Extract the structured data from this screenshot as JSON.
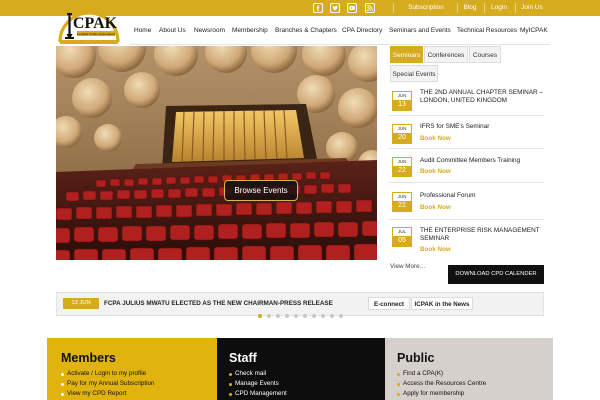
{
  "topbar": {
    "social_icons": [
      "facebook-icon",
      "twitter-icon",
      "youtube-icon",
      "rss-icon"
    ],
    "links": [
      "Subscription Renewal",
      "Blog",
      "Login",
      "Join Us"
    ]
  },
  "brand": {
    "logo_text": "CPAK",
    "logo_tagline": "Certified Public Accountants"
  },
  "nav": {
    "items": [
      "Home",
      "About Us",
      "Newsroom",
      "Membership",
      "Branches & Chapters",
      "CPA Directory",
      "Seminars and Events",
      "Technical Resources",
      "MyICPAK"
    ]
  },
  "hero": {
    "button_label": "Browse Events"
  },
  "events": {
    "tabs": [
      "Seminars",
      "Conferences",
      "Courses",
      "Special Events"
    ],
    "active_tab": "Seminars",
    "items": [
      {
        "month": "JUN",
        "day": "13",
        "title": "THE 2ND ANNUAL CHAPTER SEMINAR – LONDON, UNITED KINGDOM",
        "book": ""
      },
      {
        "month": "JUN",
        "day": "20",
        "title": "IFRS for SME's Seminar",
        "book": "Book Now"
      },
      {
        "month": "JUN",
        "day": "22",
        "title": "Audit Committee Members Training",
        "book": "Book Now"
      },
      {
        "month": "JUN",
        "day": "22",
        "title": "Professional Forum",
        "book": "Book Now"
      },
      {
        "month": "JUL",
        "day": "05",
        "title": "THE ENTERPRISE RISK MANAGEMENT SEMINAR",
        "book": "Book Now"
      }
    ],
    "view_more": "View More…",
    "cpd_button": "DOWNLOAD CPD CALENDER"
  },
  "ticker": {
    "date": "13 JUN",
    "headline": "FCPA JULIUS MWATU ELECTED AS THE NEW CHAIRMAN-PRESS RELEASE",
    "buttons": [
      "E-connect",
      "ICPAK in the News"
    ],
    "slides": 10,
    "active_slide": 1
  },
  "columns": [
    {
      "title": "Members",
      "items": [
        "Activate / Login to my profile",
        "Pay for my Annual Subscription",
        "View my CPD Report"
      ]
    },
    {
      "title": "Staff",
      "items": [
        "Check mail",
        "Manage Events",
        "CPD Management"
      ]
    },
    {
      "title": "Public",
      "items": [
        "Find a CPA(K)",
        "Access the Resources Centre",
        "Apply for membership"
      ]
    }
  ],
  "colors": {
    "accent": "#d6ab1e",
    "members_bg": "#e0b30f",
    "staff_bg": "#0d0d0d",
    "public_bg": "#d6d0cd",
    "seat_red": "#b0201e"
  }
}
